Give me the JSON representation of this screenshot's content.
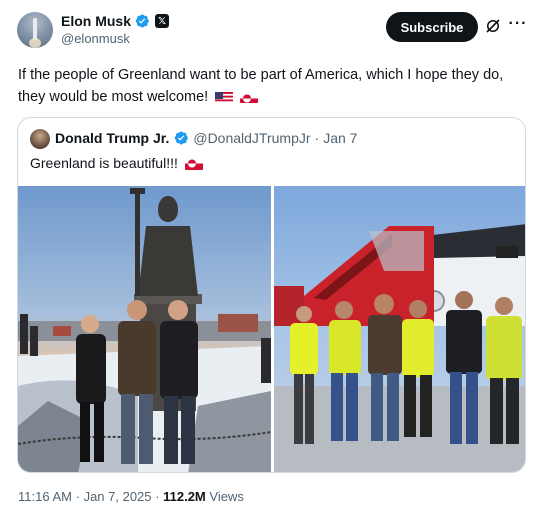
{
  "author": {
    "name": "Elon Musk",
    "handle": "@elonmusk",
    "verified": true,
    "badge_icon": "x-logo-icon"
  },
  "actions": {
    "subscribe_label": "Subscribe",
    "grok_icon": "grok-icon",
    "more_icon": "more-icon"
  },
  "post": {
    "text": "If the people of Greenland want to be part of America, which I hope they do, they would be most welcome!",
    "emojis": [
      "us-flag",
      "greenland-flag"
    ]
  },
  "quoted_post": {
    "author_name": "Donald Trump Jr.",
    "handle": "@DonaldJTrumpJr",
    "separator": "·",
    "date": "Jan 7",
    "verified": true,
    "text": "Greenland is beautiful!!!",
    "emoji": "greenland-flag",
    "media": [
      {
        "name": "photo-statue-group",
        "description_icon": "photo"
      },
      {
        "name": "photo-crew-plane",
        "description_icon": "photo"
      }
    ]
  },
  "meta": {
    "time": "11:16 AM",
    "separator1": "·",
    "date": "Jan 7, 2025",
    "separator2": "·",
    "views_count": "112.2M",
    "views_label": "Views"
  },
  "colors": {
    "verified_blue": "#1d9bf0",
    "text_primary": "#0f1419",
    "text_secondary": "#536471",
    "border": "#cfd9de"
  }
}
